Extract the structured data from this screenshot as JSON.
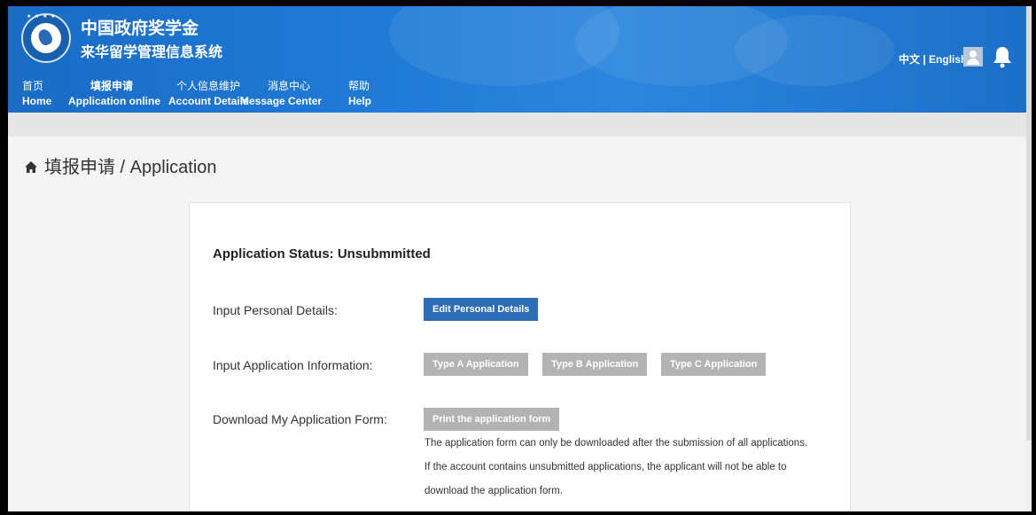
{
  "header": {
    "title_line1": "中国政府奖学金",
    "title_line2": "来华留学管理信息系统",
    "lang_switch": "中文 | English",
    "colors": {
      "header_blue": "#1f7ad6",
      "primary_button": "#2d6db5",
      "disabled_button": "#b3b3b3"
    }
  },
  "nav": [
    {
      "cn": "首页",
      "en": "Home"
    },
    {
      "cn": "填报申请",
      "en": "Application online"
    },
    {
      "cn": "个人信息维护",
      "en": "Account Details"
    },
    {
      "cn": "消息中心",
      "en": "Message Center"
    },
    {
      "cn": "帮助",
      "en": "Help"
    }
  ],
  "breadcrumb": {
    "text": "填报申请 / Application",
    "icon": "home-icon"
  },
  "main": {
    "status": "Application Status: Unsubmmitted",
    "rows": [
      {
        "label": "Input Personal Details:"
      },
      {
        "label": "Input Application Information:"
      },
      {
        "label": "Download My Application Form:"
      }
    ],
    "buttons": {
      "edit_personal": "Edit Personal Details",
      "type_a": "Type A Application",
      "type_b": "Type B Application",
      "type_c": "Type C Application",
      "print_form": "Print the application form"
    },
    "notes": [
      "The application form can only be downloaded after the submission of all applications.",
      "If the account contains unsubmitted applications, the applicant will not be able to",
      "download the application form."
    ]
  }
}
